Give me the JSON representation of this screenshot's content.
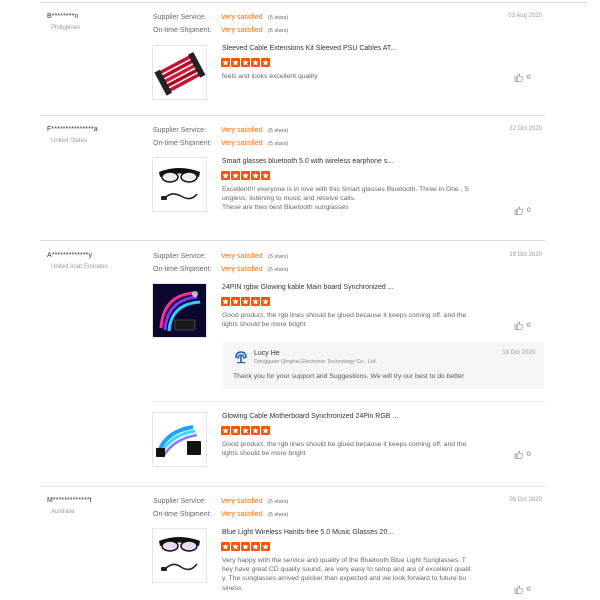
{
  "labels": {
    "supplier_service": "Supplier Service:",
    "shipment": "On-time Shipment:",
    "stars_suffix": "(5 stars)"
  },
  "reviews": [
    {
      "buyer": "B********n",
      "country": "Philippines",
      "date": "03 Aug 2020",
      "supplier_rating": "Very satisfied",
      "shipment_rating": "Very satisfied",
      "products": [
        {
          "title": "Sleeved Cable Extensions Kit Sleeved PSU Cables AT...",
          "stars": 5,
          "text": "feels and looks excellent quality",
          "likes": "0"
        }
      ]
    },
    {
      "buyer": "F***************a",
      "country": "United States",
      "date": "22 Oct 2020",
      "supplier_rating": "Very satisfied",
      "shipment_rating": "Very satisfied",
      "products": [
        {
          "title": "Smart glasses bluetooth 5.0 with wireless earphone s...",
          "stars": 5,
          "text": "Excellent!!! everyone is in love with this Smart glasses Bluetooth. Three in One , S\nungless, listening to music and receive calls.\nThese are thes best Bluetooth sunglasses",
          "likes": "0"
        }
      ]
    },
    {
      "buyer": "A*************y",
      "country": "United Arab Emirates",
      "date": "18 Oct 2020",
      "supplier_rating": "Very satisfied",
      "shipment_rating": "Very satisfied",
      "products": [
        {
          "title": "24PIN rgbw Glowing kable Main board Synchronized ...",
          "stars": 5,
          "text": "Good product, the rgb lines should be glued because it keeps coming off.  and the\nlights should be more bright",
          "likes": "0"
        },
        {
          "title": "Glowing Cable Motherboard Synchronized 24Pin RGB ...",
          "stars": 5,
          "text": "Good product, the rgb lines should be glued because it keeps coming off.  and the\nlights should be more bright",
          "likes": "0"
        }
      ],
      "reply": {
        "name": "Lucy He",
        "company": "Dongguan Qinghai Electronic Technology Co., Ltd.",
        "date": "18 Oct 2020",
        "text": "Thank you for your support and Suggestions. We will try our best to do better"
      }
    },
    {
      "buyer": "M*************t",
      "country": "Australia",
      "date": "08 Oct 2020",
      "supplier_rating": "Very satisfied",
      "shipment_rating": "Very satisfied",
      "products": [
        {
          "title": "Blue Light Wireless Hands-free 5.0 Music Glasses 20...",
          "stars": 5,
          "text": "Very happy with the service and quality of the Bluetooth Blue Light Sunglasses. T\nhey have great CD quality sound, are very easy to setup and are of excellent qualit\ny. The sunglasses arrived quicker than expected and we look forward to future bu\nsiness.",
          "likes": "0"
        }
      ]
    }
  ]
}
